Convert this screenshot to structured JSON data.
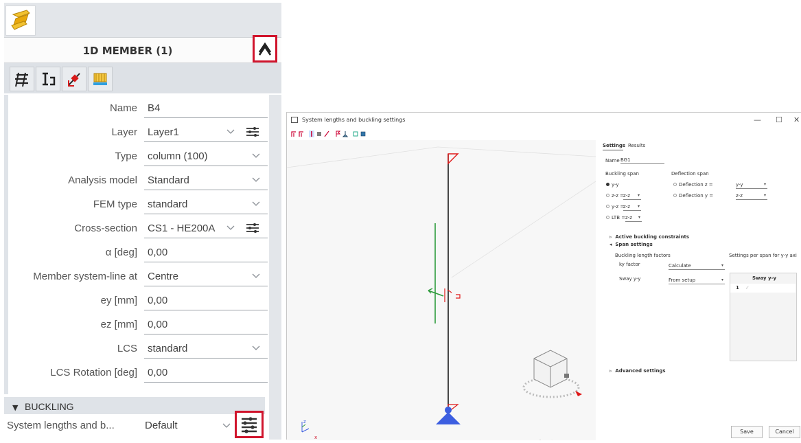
{
  "member_panel": {
    "title": "1D MEMBER (1)",
    "properties": [
      {
        "label": "Name",
        "value": "B4",
        "control": "text"
      },
      {
        "label": "Layer",
        "value": "Layer1",
        "control": "select-config"
      },
      {
        "label": "Type",
        "value": "column (100)",
        "control": "select"
      },
      {
        "label": "Analysis model",
        "value": "Standard",
        "control": "select"
      },
      {
        "label": "FEM type",
        "value": "standard",
        "control": "select"
      },
      {
        "label": "Cross-section",
        "value": "CS1 - HE200A",
        "control": "select-config"
      },
      {
        "label": "α [deg]",
        "value": "0,00",
        "control": "text"
      },
      {
        "label": "Member system-line at",
        "value": "Centre",
        "control": "select"
      },
      {
        "label": "ey [mm]",
        "value": "0,00",
        "control": "text"
      },
      {
        "label": "ez [mm]",
        "value": "0,00",
        "control": "text"
      },
      {
        "label": "LCS",
        "value": "standard",
        "control": "select"
      },
      {
        "label": "LCS Rotation [deg]",
        "value": "0,00",
        "control": "text"
      }
    ],
    "buckling": {
      "header": "BUCKLING",
      "label": "System lengths and b...",
      "value": "Default"
    }
  },
  "dialog": {
    "title": "System lengths and buckling settings",
    "window_buttons": [
      "—",
      "☐",
      "✕"
    ],
    "tabs": [
      "Settings",
      "Results"
    ],
    "name_label": "Name",
    "name_value": "BG1",
    "buckling_span_label": "Buckling span",
    "deflection_span_label": "Deflection span",
    "buckling_options": [
      {
        "label": "y-y",
        "selected": true,
        "select": ""
      },
      {
        "label": "z-z =",
        "selected": false,
        "select": "z-z"
      },
      {
        "label": "y-z =",
        "selected": false,
        "select": "z-z"
      },
      {
        "label": "LTB =",
        "selected": false,
        "select": "z-z"
      }
    ],
    "deflection_options": [
      {
        "label": "Deflection z =",
        "select": "y-y"
      },
      {
        "label": "Deflection y =",
        "select": "z-z"
      }
    ],
    "active_buckling": "Active buckling constraints",
    "span_settings": "Span settings",
    "length_factors_label": "Buckling length factors",
    "ky_label": "ky factor",
    "ky_value": "Calculate",
    "sway_label": "Sway y-y",
    "sway_value": "From setup",
    "per_span_label": "Settings per span for y-y axi",
    "table_header": "Sway y-y",
    "table_row_index": "1",
    "advanced": "Advanced settings",
    "save_label": "Save",
    "cancel_label": "Cancel",
    "axis_z": "z",
    "axis_x": "x"
  },
  "colors": {
    "highlight": "#d0142c",
    "member_line": "#1a1a1a",
    "support": "#3c5ee0",
    "load": "#2e9b3c",
    "marker": "#e01818"
  }
}
